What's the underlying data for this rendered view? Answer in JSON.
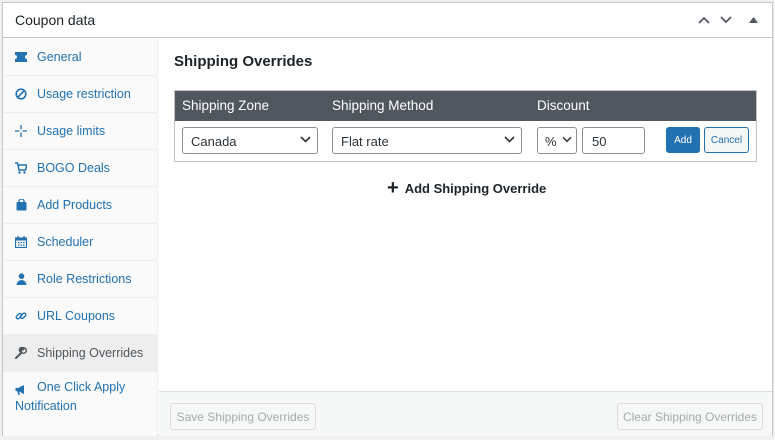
{
  "panel": {
    "title": "Coupon data",
    "controls": [
      "chevron-up-icon",
      "chevron-down-icon",
      "triangle-up-icon"
    ]
  },
  "sidebar": {
    "items": [
      {
        "label": "General",
        "icon": "ticket-icon",
        "active": false
      },
      {
        "label": "Usage restriction",
        "icon": "block-icon",
        "active": false
      },
      {
        "label": "Usage limits",
        "icon": "crosshair-icon",
        "active": false
      },
      {
        "label": "BOGO Deals",
        "icon": "cart-icon",
        "active": false
      },
      {
        "label": "Add Products",
        "icon": "bag-icon",
        "active": false
      },
      {
        "label": "Scheduler",
        "icon": "calendar-icon",
        "active": false
      },
      {
        "label": "Role Restrictions",
        "icon": "person-icon",
        "active": false
      },
      {
        "label": "URL Coupons",
        "icon": "link-icon",
        "active": false
      },
      {
        "label": "Shipping Overrides",
        "icon": "wrench-icon",
        "active": true
      },
      {
        "label": "One Click Apply Notification",
        "icon": "megaphone-icon",
        "active": false
      }
    ]
  },
  "main": {
    "title": "Shipping Overrides",
    "table": {
      "headers": [
        "Shipping Zone",
        "Shipping Method",
        "Discount"
      ],
      "row": {
        "zone": "Canada",
        "method": "Flat rate",
        "discount_type": "%",
        "discount_value": "50",
        "add_label": "Add",
        "cancel_label": "Cancel"
      }
    },
    "add_override_label": "Add Shipping Override",
    "footer": {
      "save_label": "Save Shipping Overrides",
      "clear_label": "Clear Shipping Overrides"
    }
  },
  "colors": {
    "accent": "#2271b1",
    "table_header": "#50575e",
    "active_nav": "#eeeeee"
  }
}
